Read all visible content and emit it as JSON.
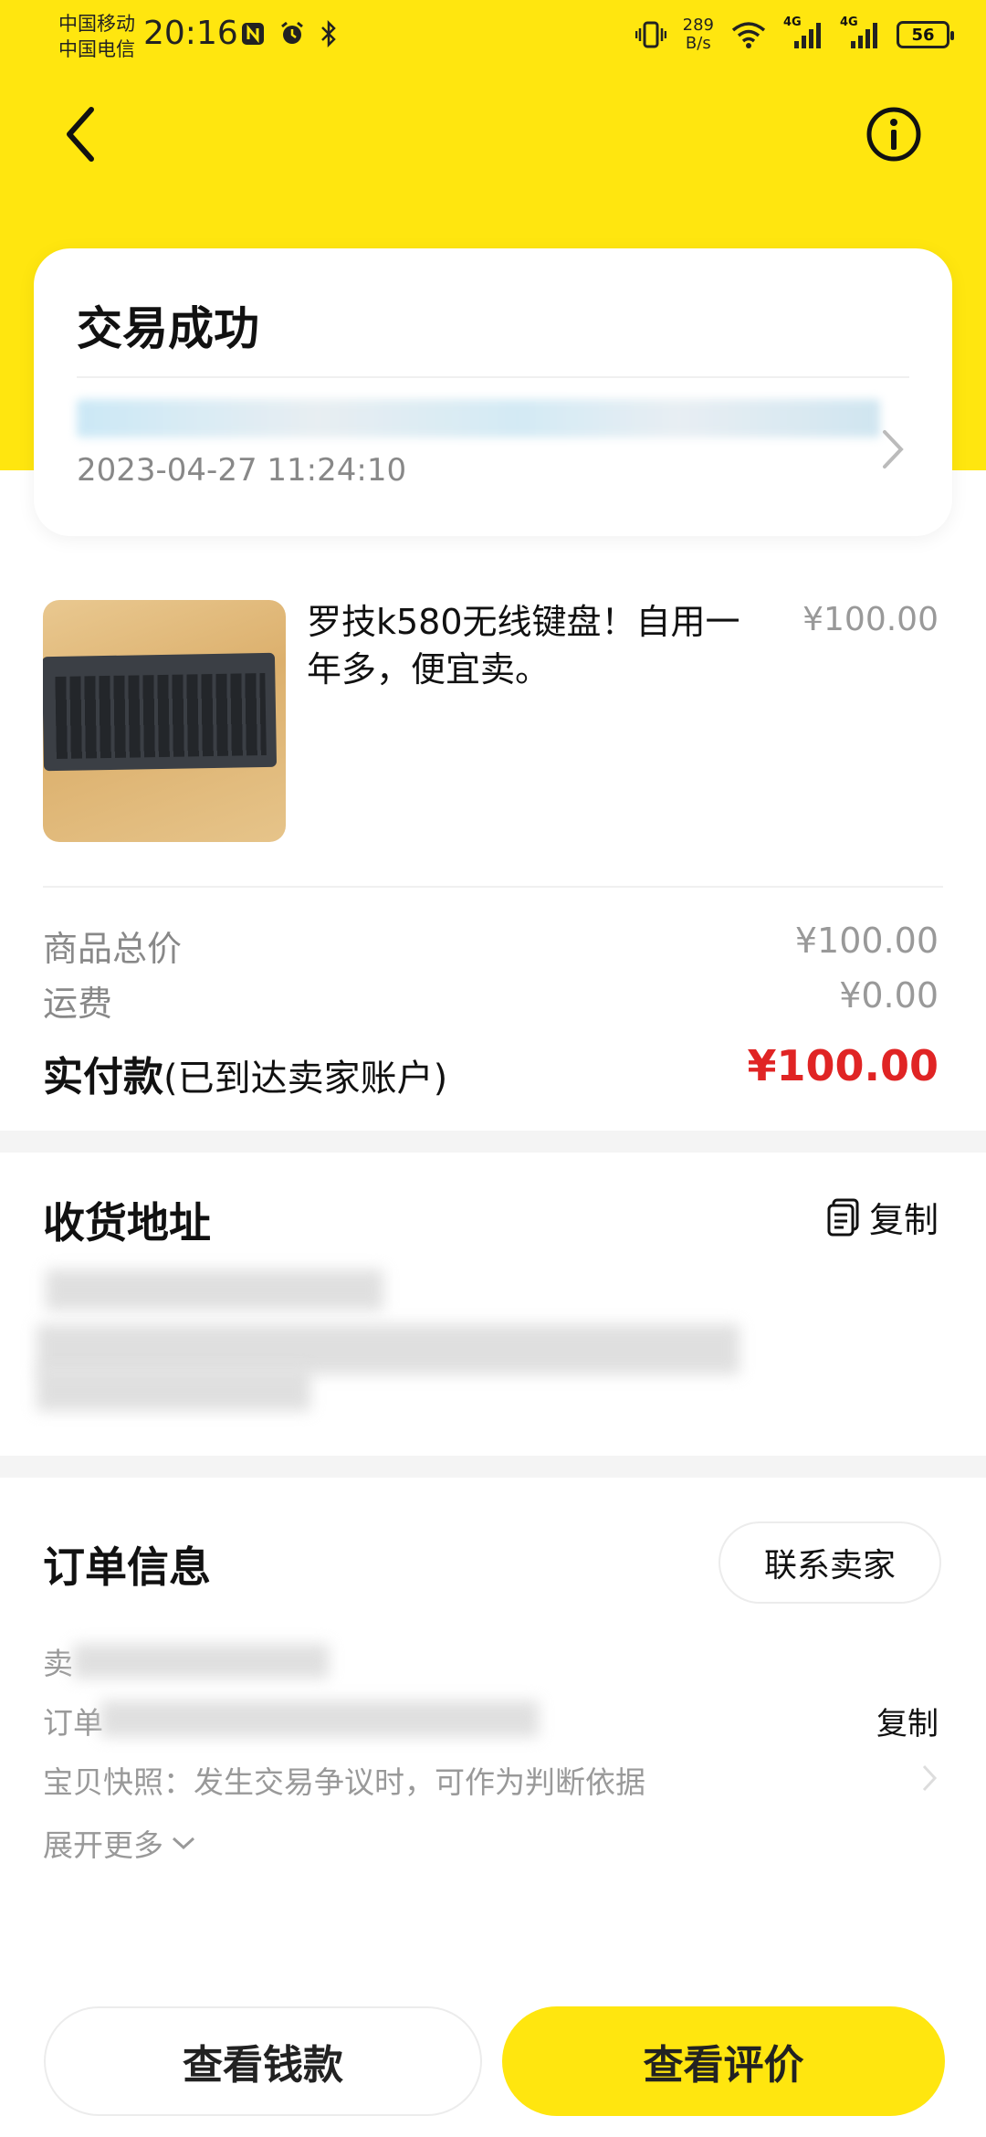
{
  "status_bar": {
    "carrier1": "中国移动",
    "carrier2": "中国电信",
    "time": "20:16",
    "speed_value": "289",
    "speed_unit": "B/s",
    "net1": "4G",
    "net2": "4G",
    "battery": "56"
  },
  "header": {
    "back_icon": "back-chevron-icon",
    "info_icon": "info-circle-icon"
  },
  "status_card": {
    "title": "交易成功",
    "time": "2023-04-27 11:24:10"
  },
  "product": {
    "title": "罗技k580无线键盘！自用一年多，便宜卖。",
    "price": "¥100.00"
  },
  "summary": {
    "items_total_label": "商品总价",
    "items_total_value": "¥100.00",
    "shipping_label": "运费",
    "shipping_value": "¥0.00",
    "paid_label": "实付款",
    "paid_note": "(已到达卖家账户)",
    "paid_value": "¥100.00"
  },
  "address": {
    "title": "收货地址",
    "copy_label": "复制"
  },
  "order_info": {
    "title": "订单信息",
    "contact_seller": "联系卖家",
    "seller_prefix": "卖",
    "order_prefix": "订单",
    "copy_label": "复制",
    "snapshot_text": "宝贝快照：发生交易争议时，可作为判断依据",
    "expand_label": "展开更多"
  },
  "bottom_bar": {
    "view_money": "查看钱款",
    "view_review": "查看评价"
  },
  "colors": {
    "brand_yellow": "#ffe60f",
    "price_red": "#e02424"
  }
}
